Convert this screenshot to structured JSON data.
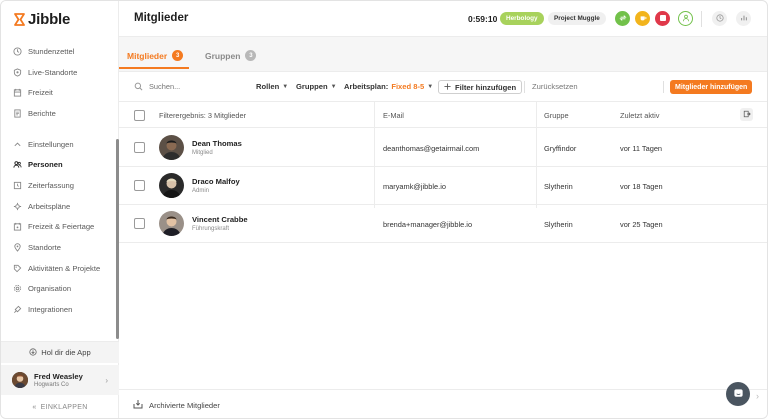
{
  "brand": {
    "name": "Jibble",
    "accent": "#f47a20"
  },
  "sidebar": {
    "items": [
      {
        "label": "Stundenzettel",
        "icon": "clock-icon"
      },
      {
        "label": "Live-Standorte",
        "icon": "location-shield-icon"
      },
      {
        "label": "Freizeit",
        "icon": "calendar-icon"
      },
      {
        "label": "Berichte",
        "icon": "report-icon"
      }
    ],
    "settings_label": "Einstellungen",
    "settings_items": [
      {
        "label": "Personen",
        "icon": "people-icon",
        "active": true
      },
      {
        "label": "Zeiterfassung",
        "icon": "time-tracking-icon"
      },
      {
        "label": "Arbeitspläne",
        "icon": "schedule-icon"
      },
      {
        "label": "Freizeit & Feiertage",
        "icon": "holiday-icon"
      },
      {
        "label": "Standorte",
        "icon": "location-icon"
      },
      {
        "label": "Aktivitäten & Projekte",
        "icon": "tag-icon"
      },
      {
        "label": "Organisation",
        "icon": "gear-icon"
      },
      {
        "label": "Integrationen",
        "icon": "plug-icon"
      }
    ],
    "get_app": "Hol dir die App",
    "user": {
      "name": "Fred Weasley",
      "org": "Hogwarts Co"
    },
    "collapse": "EINKLAPPEN"
  },
  "header": {
    "title": "Mitglieder",
    "timer": "0:59:10",
    "activity": "Herbology",
    "project": "Project Muggle"
  },
  "tabs": [
    {
      "label": "Mitglieder",
      "count": "3"
    },
    {
      "label": "Gruppen",
      "count": "3"
    }
  ],
  "toolbar": {
    "search_placeholder": "Suchen...",
    "roles": "Rollen",
    "groups": "Gruppen",
    "plan_label": "Arbeitsplan:",
    "plan_value": "Fixed 8-5",
    "add_filter": "Filter hinzufügen",
    "reset": "Zurücksetzen",
    "add_members": "Mitglieder hinzufügen"
  },
  "table": {
    "headers": {
      "result": "Filterergebnis: 3 Mitglieder",
      "email": "E-Mail",
      "group": "Gruppe",
      "last_active": "Zuletzt aktiv"
    },
    "rows": [
      {
        "name": "Dean Thomas",
        "role": "Mitglied",
        "email": "deanthomas@getairmail.com",
        "group": "Gryffindor",
        "last_active": "vor 11 Tagen"
      },
      {
        "name": "Draco Malfoy",
        "role": "Admin",
        "email": "maryamk@jibble.io",
        "group": "Slytherin",
        "last_active": "vor 18 Tagen"
      },
      {
        "name": "Vincent Crabbe",
        "role": "Führungskraft",
        "email": "brenda+manager@jibble.io",
        "group": "Slytherin",
        "last_active": "vor 25 Tagen"
      }
    ]
  },
  "archive": "Archivierte Mitglieder"
}
